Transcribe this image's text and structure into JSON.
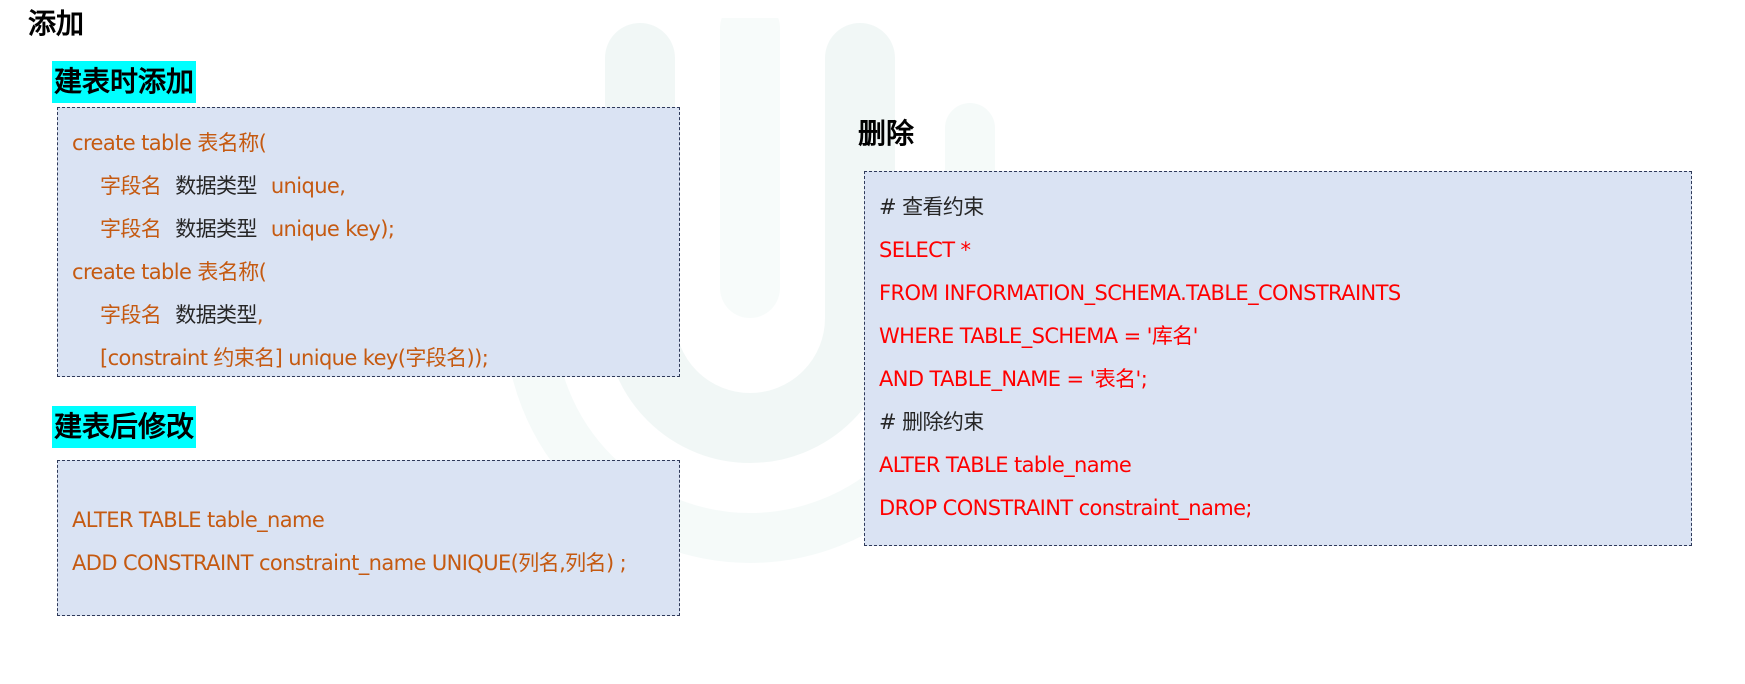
{
  "title": "添加",
  "delete_title": "删除",
  "sections": {
    "on_create": {
      "heading": "建表时添加",
      "lines": {
        "l1": "create table 表名称(",
        "l2_a": "字段名",
        "l2_b": "数据类型",
        "l2_c": "unique,",
        "l3_a": "字段名",
        "l3_b": "数据类型",
        "l3_c": "unique key);",
        "l4": "create table 表名称(",
        "l5_a": "字段名",
        "l5_b": "数据类型",
        "l5_c": ",",
        "l6": "[constraint 约束名] unique key(字段名));"
      }
    },
    "after_create": {
      "heading": "建表后修改",
      "lines": {
        "l1": "ALTER TABLE table_name",
        "l2": "ADD CONSTRAINT constraint_name UNIQUE(列名,列名) ;"
      }
    },
    "delete": {
      "lines": {
        "c1": "# 查看约束",
        "l1": "SELECT *",
        "l2": "FROM INFORMATION_SCHEMA.TABLE_CONSTRAINTS",
        "l3": "WHERE TABLE_SCHEMA = '库名'",
        "l4": "AND TABLE_NAME = '表名';",
        "c2": "# 删除约束",
        "l5": "ALTER TABLE table_name",
        "l6": "DROP CONSTRAINT constraint_name;"
      }
    }
  },
  "colors": {
    "code_orange": "#c55a11",
    "code_red": "#ff0000",
    "code_box_bg": "#dae3f3",
    "heading_highlight": "#00ffff"
  }
}
